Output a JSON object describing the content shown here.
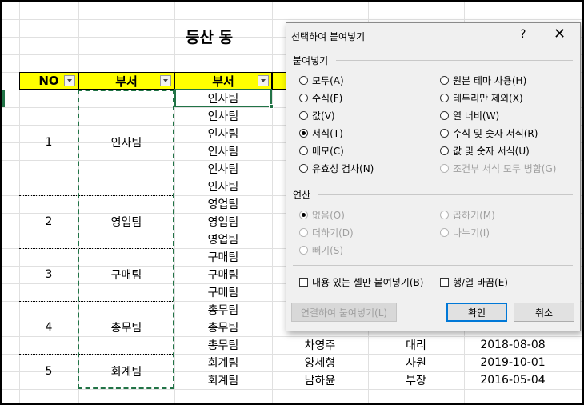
{
  "sheet": {
    "title": "등산 동",
    "headers": {
      "no": "NO",
      "dept1": "부서",
      "dept2": "부서"
    },
    "groups": [
      {
        "no": "1",
        "dept": "인사팀"
      },
      {
        "no": "2",
        "dept": "영업팀"
      },
      {
        "no": "3",
        "dept": "구매팀"
      },
      {
        "no": "4",
        "dept": "총무팀"
      },
      {
        "no": "5",
        "dept": "회계팀"
      }
    ],
    "rows": [
      {
        "dept": "인사팀",
        "name": "",
        "rank": "",
        "date": ""
      },
      {
        "dept": "인사팀",
        "name": "",
        "rank": "",
        "date": ""
      },
      {
        "dept": "인사팀",
        "name": "",
        "rank": "",
        "date": ""
      },
      {
        "dept": "인사팀",
        "name": "",
        "rank": "",
        "date": ""
      },
      {
        "dept": "인사팀",
        "name": "",
        "rank": "",
        "date": ""
      },
      {
        "dept": "인사팀",
        "name": "",
        "rank": "",
        "date": ""
      },
      {
        "dept": "영업팀",
        "name": "",
        "rank": "",
        "date": ""
      },
      {
        "dept": "영업팀",
        "name": "",
        "rank": "",
        "date": ""
      },
      {
        "dept": "영업팀",
        "name": "",
        "rank": "",
        "date": ""
      },
      {
        "dept": "구매팀",
        "name": "",
        "rank": "",
        "date": ""
      },
      {
        "dept": "구매팀",
        "name": "",
        "rank": "",
        "date": ""
      },
      {
        "dept": "구매팀",
        "name": "",
        "rank": "",
        "date": ""
      },
      {
        "dept": "총무팀",
        "name": "",
        "rank": "",
        "date": ""
      },
      {
        "dept": "총무팀",
        "name": "",
        "rank": "",
        "date": ""
      },
      {
        "dept": "총무팀",
        "name": "차영주",
        "rank": "대리",
        "date": "2018-08-08"
      },
      {
        "dept": "회계팀",
        "name": "양세형",
        "rank": "사원",
        "date": "2019-10-01"
      },
      {
        "dept": "회계팀",
        "name": "남하윤",
        "rank": "부장",
        "date": "2016-05-04"
      }
    ]
  },
  "dialog": {
    "title": "선택하여 붙여넣기",
    "help": "?",
    "close": "✕",
    "paste_section": "붙여넣기",
    "paste_left": [
      "모두(A)",
      "수식(F)",
      "값(V)",
      "서식(T)",
      "메모(C)",
      "유효성 검사(N)"
    ],
    "paste_right": [
      "원본 테마 사용(H)",
      "테두리만 제외(X)",
      "열 너비(W)",
      "수식 및 숫자 서식(R)",
      "값 및 숫자 서식(U)",
      "조건부 서식 모두 병합(G)"
    ],
    "op_section": "연산",
    "op_left": [
      "없음(O)",
      "더하기(D)",
      "빼기(S)"
    ],
    "op_right": [
      "곱하기(M)",
      "나누기(I)"
    ],
    "skip_blanks": "내용 있는 셀만 붙여넣기(B)",
    "transpose": "행/열 바꿈(E)",
    "paste_link": "연결하여 붙여넣기(L)",
    "ok": "확인",
    "cancel": "취소"
  }
}
